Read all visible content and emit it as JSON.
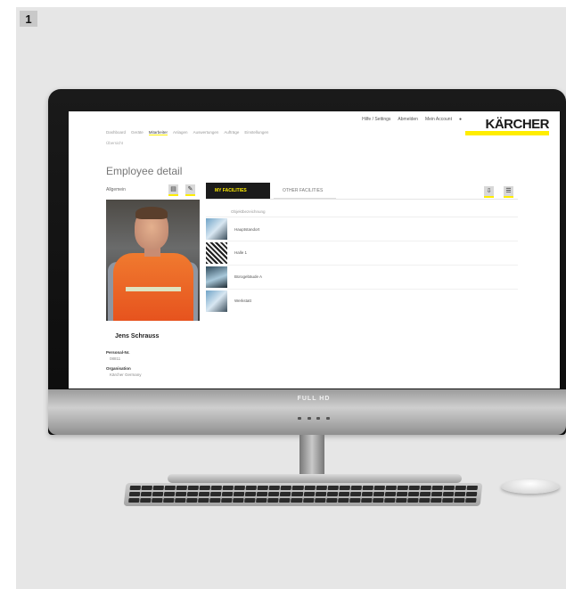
{
  "step_badge": "1",
  "monitor": {
    "brand_label": "FULL HD"
  },
  "app": {
    "logo": "KÄRCHER",
    "top_links": [
      "Hilfe / Settings",
      "Abmelden",
      "Mein Account"
    ],
    "nav_items": [
      "Dashboard",
      "Geräte",
      "Mitarbeiter",
      "Anlagen",
      "Auswertungen",
      "Aufträge",
      "Einstellungen"
    ],
    "nav_sub": "Übersicht",
    "page_title": "Employee detail",
    "left_caption": "Allgemein",
    "person_name": "Jens Schrauss",
    "fields": [
      {
        "label": "Personal-Nr.",
        "value": "08811"
      },
      {
        "label": "Organisation",
        "value": "Kärcher Germany"
      }
    ],
    "tabs": {
      "active": "MY FACILITIES",
      "inactive": "OTHER FACILITIES"
    },
    "list_header": "Objektbezeichnung",
    "facilities": [
      "Hauptstandort",
      "Halle 1",
      "Bürogebäude A",
      "Werkstatt"
    ]
  }
}
